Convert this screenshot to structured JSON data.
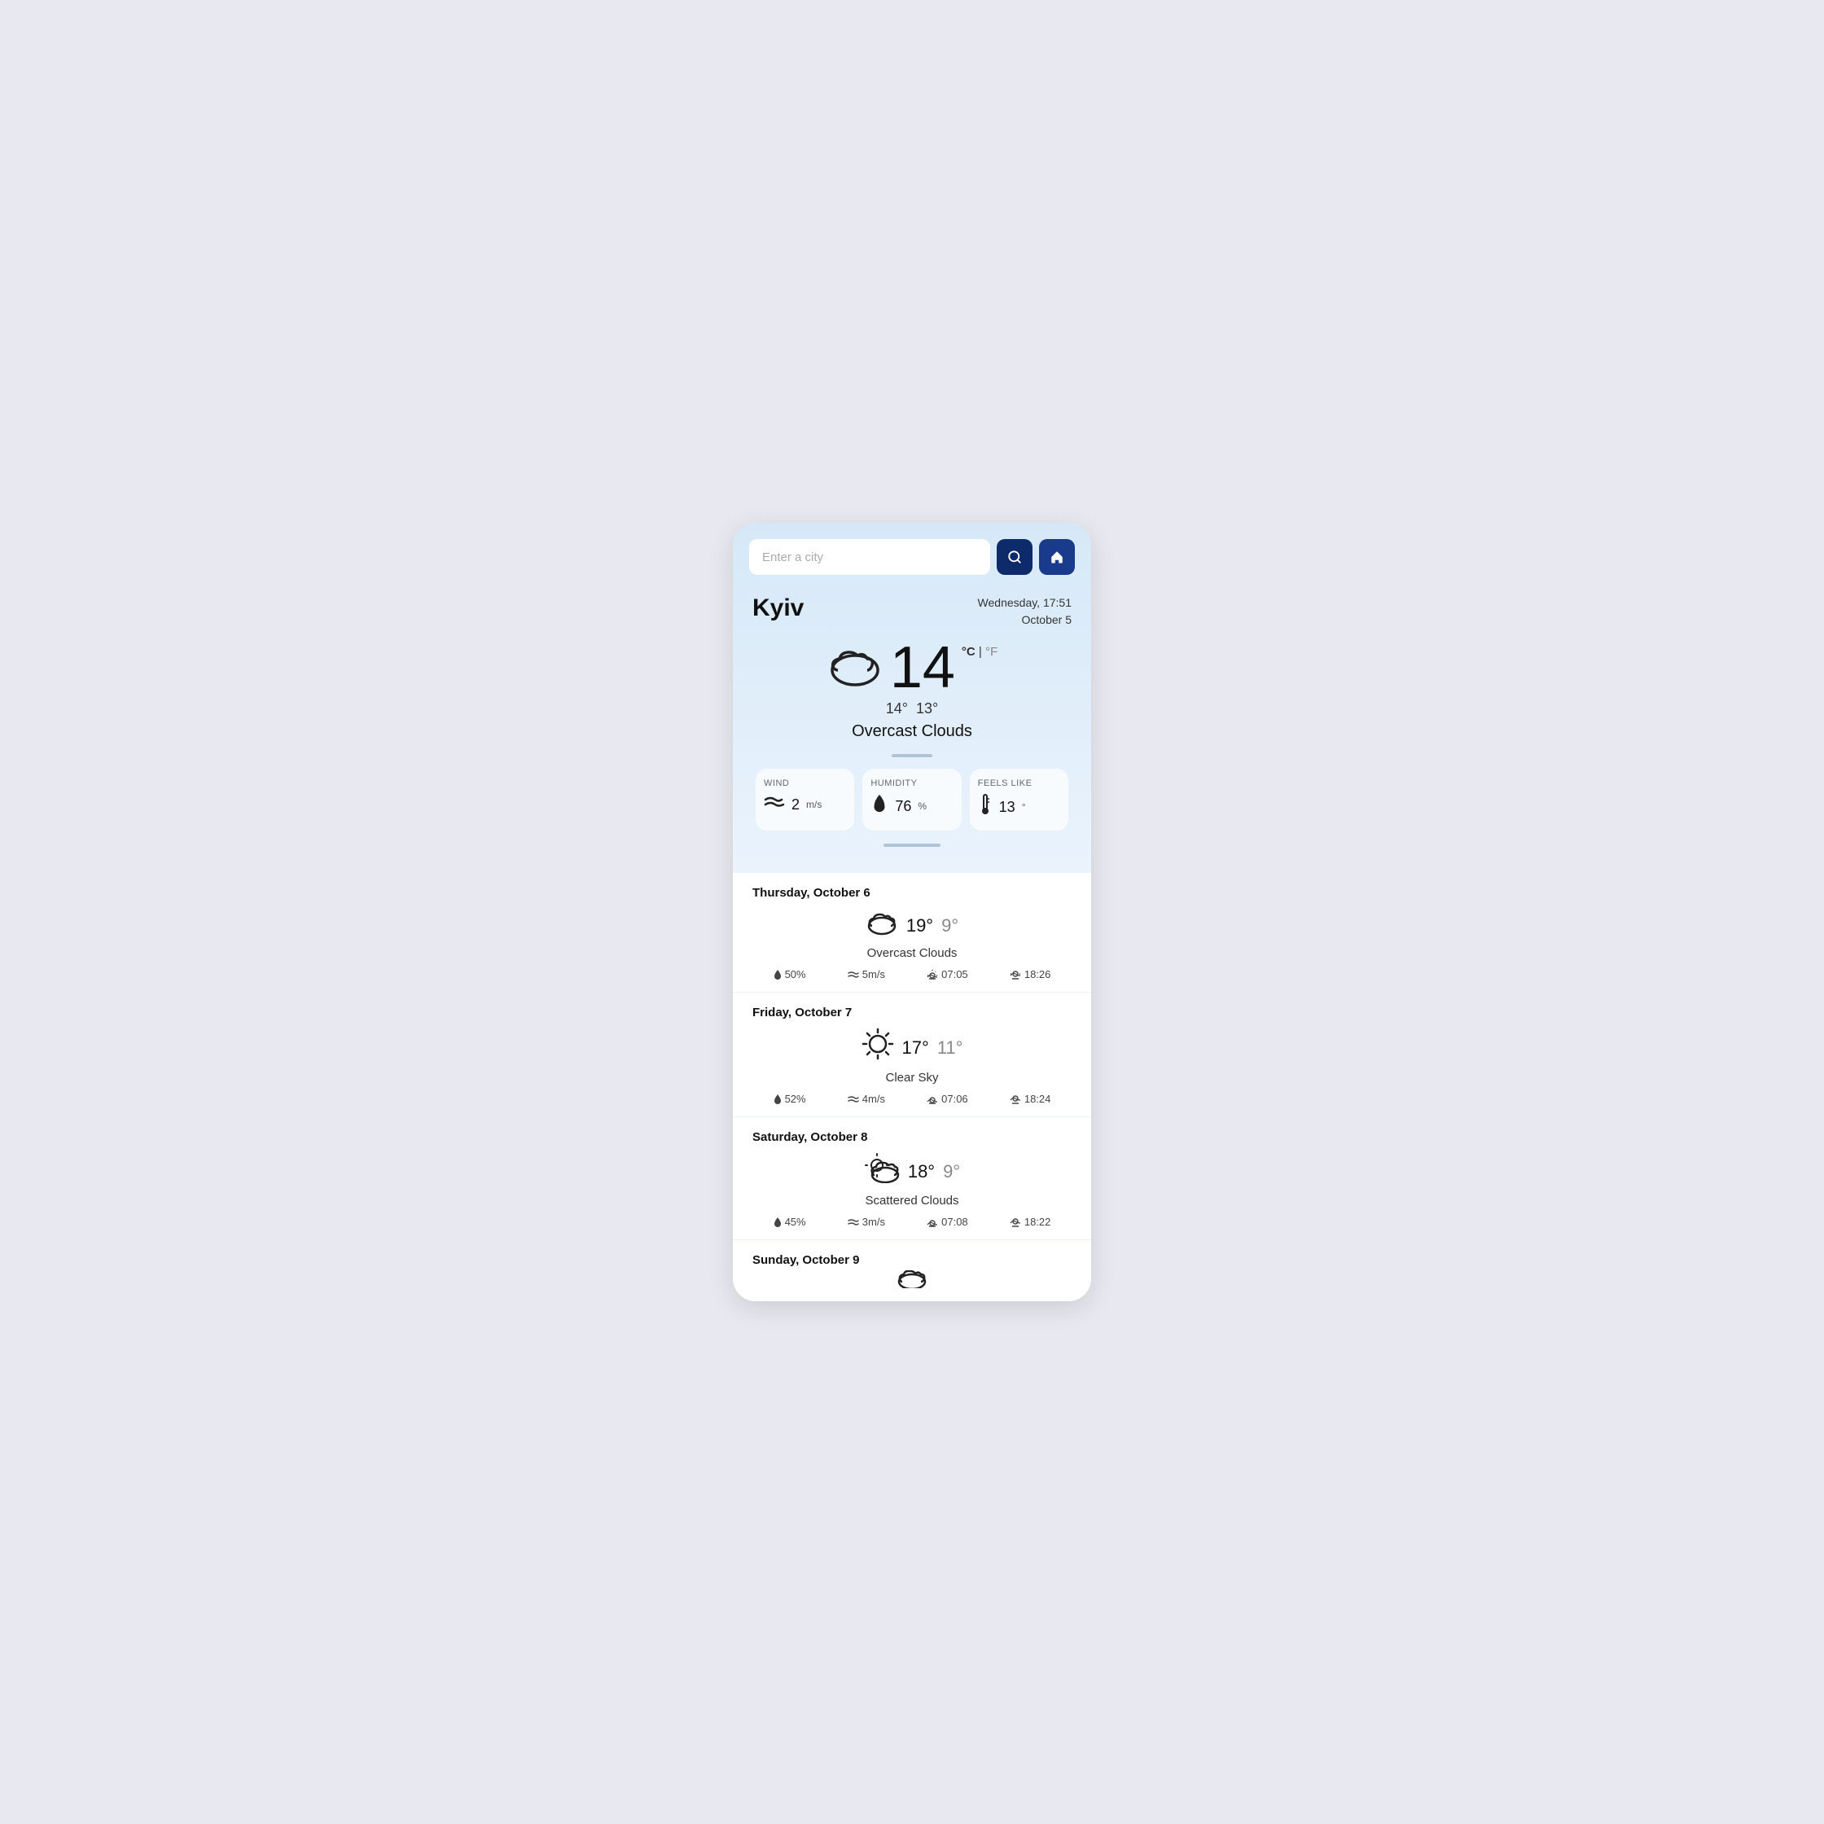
{
  "search": {
    "placeholder": "Enter a city"
  },
  "header": {
    "city": "Kyiv",
    "datetime_line1": "Wednesday, 17:51",
    "datetime_line2": "October 5"
  },
  "current": {
    "temp": "14",
    "unit_c": "°C",
    "separator": "|",
    "unit_f": "°F",
    "temp_high": "14°",
    "temp_low": "13°",
    "description": "Overcast Clouds"
  },
  "stats": {
    "wind": {
      "label": "WIND",
      "value": "2",
      "unit": "m/s"
    },
    "humidity": {
      "label": "HUMIDITY",
      "value": "76",
      "unit": "%"
    },
    "feels_like": {
      "label": "FEELS LIKE",
      "value": "13",
      "unit": "°"
    }
  },
  "forecast": [
    {
      "day": "Thursday, October 6",
      "icon": "cloud",
      "high": "19°",
      "low": "9°",
      "description": "Overcast Clouds",
      "humidity": "50%",
      "wind": "5m/s",
      "sunrise": "07:05",
      "sunset": "18:26"
    },
    {
      "day": "Friday, October 7",
      "icon": "sun",
      "high": "17°",
      "low": "11°",
      "description": "Clear Sky",
      "humidity": "52%",
      "wind": "4m/s",
      "sunrise": "07:06",
      "sunset": "18:24"
    },
    {
      "day": "Saturday, October 8",
      "icon": "partly-cloudy",
      "high": "18°",
      "low": "9°",
      "description": "Scattered Clouds",
      "humidity": "45%",
      "wind": "3m/s",
      "sunrise": "07:08",
      "sunset": "18:22"
    },
    {
      "day": "Sunday, October 9",
      "icon": "cloud",
      "high": "",
      "low": "",
      "description": "",
      "humidity": "",
      "wind": "",
      "sunrise": "",
      "sunset": ""
    }
  ],
  "icons": {
    "search": "🔍",
    "home": "🏠",
    "wind": "💨",
    "drop": "💧",
    "thermometer": "🌡",
    "sunrise": "🌅",
    "sunset": "🌇"
  }
}
